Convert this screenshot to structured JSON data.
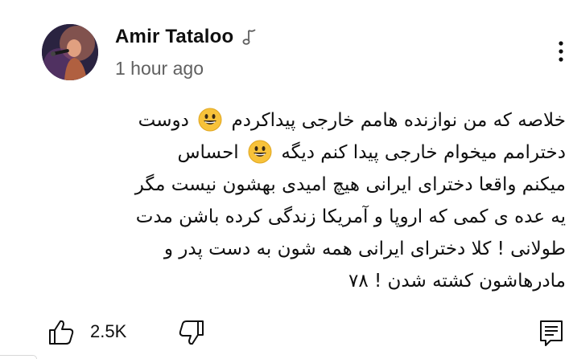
{
  "comment": {
    "author": "Amir Tataloo",
    "timestamp": "1 hour ago",
    "lines": [
      {
        "before": "خلاصه که من نوازنده هامم خارجی پیداکردم",
        "emoji": "grinning-face",
        "after": "دوست"
      },
      {
        "before": "دخترامم میخوام خارجی پیدا کنم دیگه",
        "emoji": "grinning-face",
        "after": "احساس"
      },
      {
        "before": "میکنم واقعا دخترای ایرانی هیچ امیدی بهشون نیست مگر",
        "emoji": "",
        "after": ""
      },
      {
        "before": "یه عده ی کمی که اروپا و آمریکا زندگی کرده باشن مدت",
        "emoji": "",
        "after": ""
      },
      {
        "before": "طولانی ! کلا دخترای ایرانی همه شون به دست پدر و",
        "emoji": "",
        "after": ""
      },
      {
        "before": "مادرهاشون کشته شدن ! ۷۸",
        "emoji": "",
        "after": ""
      }
    ]
  },
  "actions": {
    "like_count": "2.5K"
  },
  "icons": {
    "author_badge": "music-note-icon",
    "more": "more-vertical-icon",
    "like": "thumbs-up-icon",
    "dislike": "thumbs-down-icon",
    "reply": "reply-comment-icon"
  },
  "colors": {
    "text": "#0f0f0f",
    "secondary_text": "#606060",
    "emoji_yellow": "#f7c23a"
  }
}
